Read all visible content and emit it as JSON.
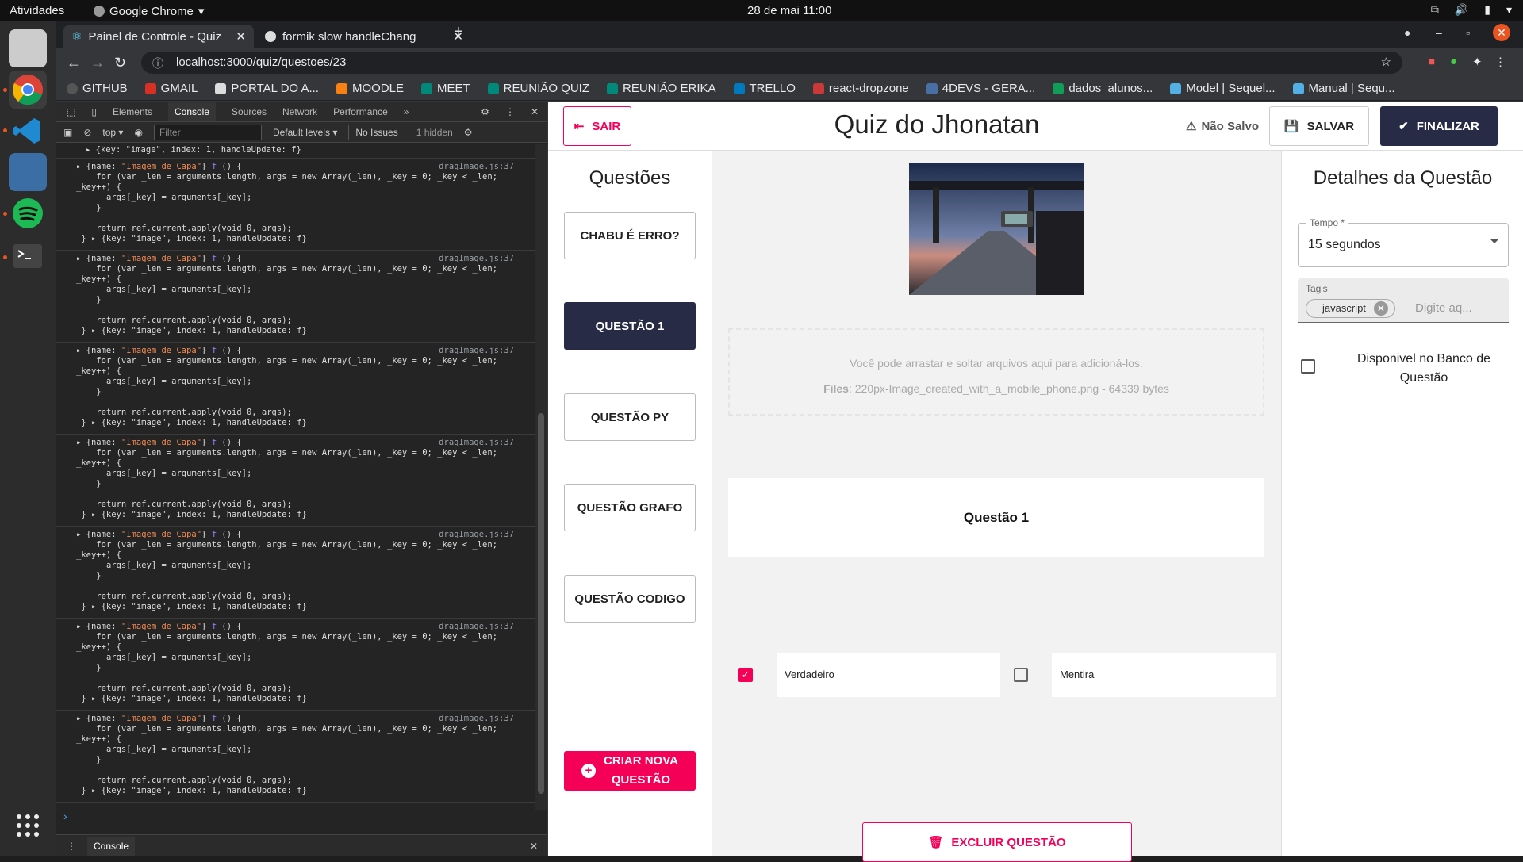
{
  "os": {
    "activities": "Atividades",
    "app_name": "Google Chrome",
    "clock": "28 de mai  11:00"
  },
  "browser": {
    "tabs": [
      {
        "title": "Painel de Controle - Quiz",
        "active": true
      },
      {
        "title": "formik slow handleChang",
        "active": false
      }
    ],
    "url": "localhost:3000/quiz/questoes/23",
    "bookmarks": [
      "GITHUB",
      "GMAIL",
      "PORTAL DO A...",
      "MOODLE",
      "MEET",
      "REUNIÃO QUIZ",
      "REUNIÃO ERIKA",
      "TRELLO",
      "react-dropzone",
      "4DEVS - GERA...",
      "dados_alunos...",
      "Model | Sequel...",
      "Manual | Sequ..."
    ]
  },
  "devtools": {
    "tabs": [
      "Elements",
      "Console",
      "Sources",
      "Network",
      "Performance"
    ],
    "active_tab": "Console",
    "context": "top",
    "filter_placeholder": "Filter",
    "levels": "Default levels",
    "issues": "No Issues",
    "hidden": "1 hidden",
    "first_line": "{key: \"image\", index: 1, handleUpdate: f}",
    "log_entries": [
      {
        "source": "dragImage.js:37",
        "name": "\"Imagem de Capa\"",
        "line2": "for (var _len = arguments.length, args = new Array(_len), _key = 0; _key < _len;",
        "line3": "_key++) {",
        "line4": "args[_key] = arguments[_key];",
        "line5": "}",
        "line6": "return ref.current.apply(void 0, args);",
        "line7": "{key: \"image\", index: 1, handleUpdate: f}"
      },
      {
        "source": "dragImage.js:37",
        "name": "\"Imagem de Capa\"",
        "line2": "for (var _len = arguments.length, args = new Array(_len), _key = 0; _key < _len;",
        "line3": "_key++) {",
        "line4": "args[_key] = arguments[_key];",
        "line5": "}",
        "line6": "return ref.current.apply(void 0, args);",
        "line7": "{key: \"image\", index: 1, handleUpdate: f}"
      },
      {
        "source": "dragImage.js:37",
        "name": "\"Imagem de Capa\"",
        "line2": "for (var _len = arguments.length, args = new Array(_len), _key = 0; _key < _len;",
        "line3": "_key++) {",
        "line4": "args[_key] = arguments[_key];",
        "line5": "}",
        "line6": "return ref.current.apply(void 0, args);",
        "line7": "{key: \"image\", index: 1, handleUpdate: f}"
      },
      {
        "source": "dragImage.js:37",
        "name": "\"Imagem de Capa\"",
        "line2": "for (var _len = arguments.length, args = new Array(_len), _key = 0; _key < _len;",
        "line3": "_key++) {",
        "line4": "args[_key] = arguments[_key];",
        "line5": "}",
        "line6": "return ref.current.apply(void 0, args);",
        "line7": "{key: \"image\", index: 1, handleUpdate: f}"
      },
      {
        "source": "dragImage.js:37",
        "name": "\"Imagem de Capa\"",
        "line2": "for (var _len = arguments.length, args = new Array(_len), _key = 0; _key < _len;",
        "line3": "_key++) {",
        "line4": "args[_key] = arguments[_key];",
        "line5": "}",
        "line6": "return ref.current.apply(void 0, args);",
        "line7": "{key: \"image\", index: 1, handleUpdate: f}"
      },
      {
        "source": "dragImage.js:37",
        "name": "\"Imagem de Capa\"",
        "line2": "for (var _len = arguments.length, args = new Array(_len), _key = 0; _key < _len;",
        "line3": "_key++) {",
        "line4": "args[_key] = arguments[_key];",
        "line5": "}",
        "line6": "return ref.current.apply(void 0, args);",
        "line7": "{key: \"image\", index: 1, handleUpdate: f}"
      },
      {
        "source": "dragImage.js:37",
        "name": "\"Imagem de Capa\"",
        "line2": "for (var _len = arguments.length, args = new Array(_len), _key = 0; _key < _len;",
        "line3": "_key++) {",
        "line4": "args[_key] = arguments[_key];",
        "line5": "}",
        "line6": "return ref.current.apply(void 0, args);",
        "line7": "{key: \"image\", index: 1, handleUpdate: f}"
      }
    ],
    "drawer_tab": "Console"
  },
  "app": {
    "exit_label": "SAIR",
    "title": "Quiz do Jhonatan",
    "unsaved": "Não Salvo",
    "save_label": "SALVAR",
    "finish_label": "FINALIZAR",
    "questions_heading": "Questões",
    "questions": [
      {
        "label": "CHABU É ERRO?",
        "selected": false
      },
      {
        "label": "QUESTÃO 1",
        "selected": true
      },
      {
        "label": "QUESTÃO PY",
        "selected": false
      },
      {
        "label": "QUESTÃO GRAFO",
        "selected": false
      },
      {
        "label": "QUESTÃO CODIGO",
        "selected": false
      }
    ],
    "new_question_line1": "CRIAR NOVA",
    "new_question_line2": "QUESTÃO",
    "dropzone_text": "Você pode arrastar e soltar arquivos aqui para adicioná-los.",
    "files_label": "Files",
    "files_value": ": 220px-Image_created_with_a_mobile_phone.png - 64339 bytes",
    "question_title": "Questão 1",
    "answers": [
      {
        "text": "Verdadeiro",
        "checked": true
      },
      {
        "text": "Mentira",
        "checked": false
      }
    ],
    "delete_label": "EXCLUIR QUESTÃO",
    "details_heading": "Detalhes da Questão",
    "time_label": "Tempo *",
    "time_value": "15 segundos",
    "tags_label": "Tag's",
    "tag_chip": "javascript",
    "tags_placeholder": "Digite aq...",
    "bank_label": "Disponivel no Banco de Questão",
    "bank_checked": false
  },
  "colors": {
    "primary_dark": "#282b45",
    "accent": "#f50057"
  }
}
